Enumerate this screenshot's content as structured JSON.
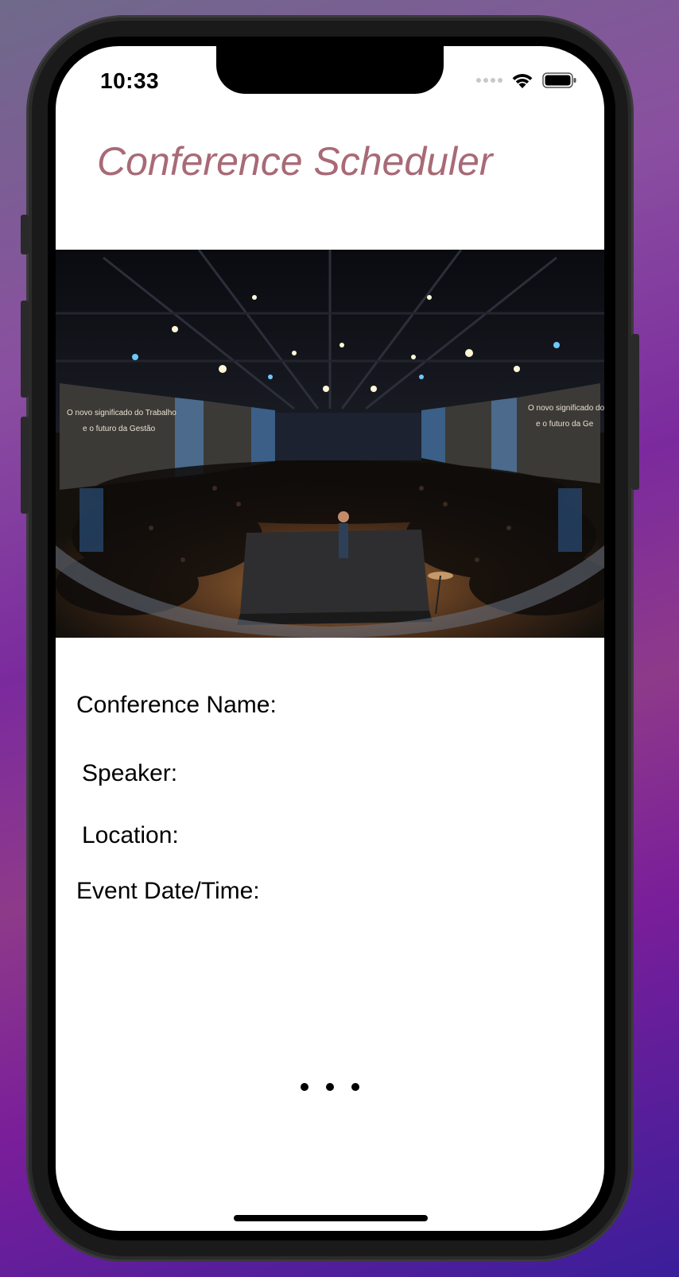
{
  "status_bar": {
    "time": "10:33",
    "icons": [
      "cellular-signal-icon",
      "wifi-icon",
      "battery-icon"
    ]
  },
  "app": {
    "title": "Conference Scheduler",
    "title_color": "#a86a76"
  },
  "hero_image": {
    "description_icon": "conference-hall-photo",
    "screen_text_left": [
      "O novo significado do Trabalho",
      "e o futuro da Gestão"
    ],
    "screen_text_right": [
      "O novo significado do",
      "e o futuro da Ge"
    ]
  },
  "form": {
    "conference_name_label": "Conference Name:",
    "speaker_label": "Speaker:",
    "location_label": "Location:",
    "event_datetime_label": "Event Date/Time:"
  },
  "pager": {
    "dots": 3
  }
}
